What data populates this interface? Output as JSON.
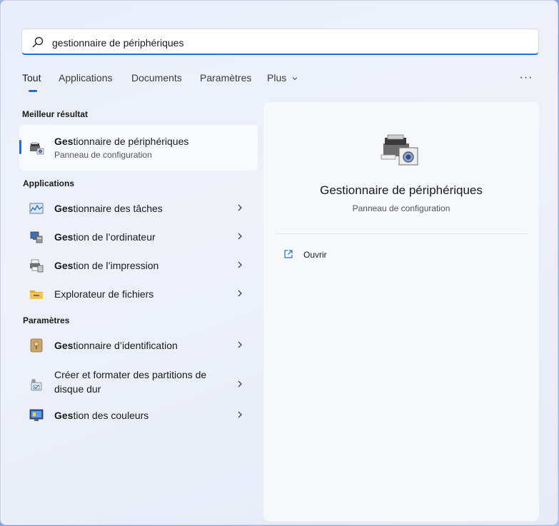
{
  "search": {
    "value": "gestionnaire de périphériques",
    "placeholder": ""
  },
  "tabs": [
    {
      "label": "Tout",
      "active": true
    },
    {
      "label": "Applications"
    },
    {
      "label": "Documents"
    },
    {
      "label": "Paramètres"
    },
    {
      "label": "Plus"
    }
  ],
  "more_label": "···",
  "best_match": {
    "section_title": "Meilleur résultat",
    "title_bold": "Ges",
    "title_rest": "tionnaire de périphériques",
    "subtitle": "Panneau de configuration",
    "icon": "device-manager-icon"
  },
  "apps": {
    "section_title": "Applications",
    "items": [
      {
        "bold": "Ges",
        "rest": "tionnaire des tâches",
        "icon": "task-manager-icon"
      },
      {
        "bold": "Ges",
        "rest": "tion de l’ordinateur",
        "icon": "computer-management-icon"
      },
      {
        "bold": "Ges",
        "rest": "tion de l’impression",
        "icon": "print-management-icon"
      },
      {
        "bold": "",
        "rest": "Explorateur de fichiers",
        "icon": "folder-icon"
      }
    ]
  },
  "settings": {
    "section_title": "Paramètres",
    "items": [
      {
        "bold": "Ges",
        "rest": "tionnaire d’identification",
        "icon": "credential-manager-icon"
      },
      {
        "bold": "",
        "rest": "Créer et formater des partitions de disque dur",
        "icon": "disk-partition-icon"
      },
      {
        "bold": "Ges",
        "rest": "tion des couleurs",
        "icon": "color-management-icon"
      }
    ]
  },
  "detail": {
    "title": "Gestionnaire de périphériques",
    "subtitle": "Panneau de configuration",
    "action_label": "Ouvrir"
  },
  "colors": {
    "accent": "#1f6fd2"
  }
}
